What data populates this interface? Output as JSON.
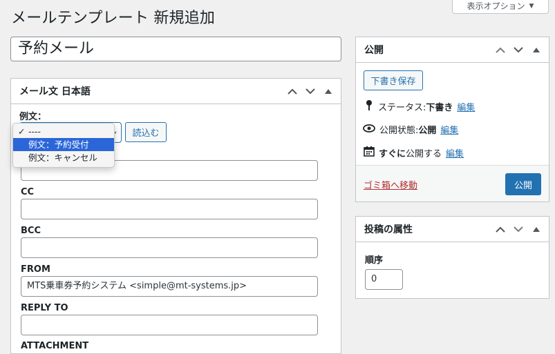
{
  "page_title": "メールテンプレート 新規追加",
  "screen_options": {
    "label": "表示オプション",
    "arrow": "▼"
  },
  "post_title": "予約メール",
  "mail_box": {
    "header": "メール文 日本語",
    "example_label": "例文：",
    "load_button": "読込む",
    "dropdown_options": [
      {
        "label": "----",
        "checked": true
      },
      {
        "label": "例文：予約受付",
        "highlighted": true
      },
      {
        "label": "例文：キャンセル"
      }
    ],
    "fields": [
      {
        "label": "",
        "value": ""
      },
      {
        "label": "CC",
        "value": ""
      },
      {
        "label": "BCC",
        "value": ""
      },
      {
        "label": "FROM",
        "value": "MTS乗車券予約システム <simple@mt-systems.jp>"
      },
      {
        "label": "REPLY TO",
        "value": ""
      },
      {
        "label": "ATTACHMENT",
        "value": ""
      }
    ]
  },
  "publish_box": {
    "header": "公開",
    "save_draft": "下書き保存",
    "status_label": "ステータス: ",
    "status_value": "下書き",
    "visibility_label": "公開状態: ",
    "visibility_value": "公開",
    "schedule_bold": "すぐに",
    "schedule_rest": "公開する",
    "edit_link": "編集",
    "trash_link": "ゴミ箱へ移動",
    "publish_button": "公開"
  },
  "attributes_box": {
    "header": "投稿の属性",
    "order_label": "順序",
    "order_value": "0"
  },
  "colors": {
    "accent": "#2271b1",
    "danger": "#b32d2e",
    "highlight": "#2b66d9"
  }
}
